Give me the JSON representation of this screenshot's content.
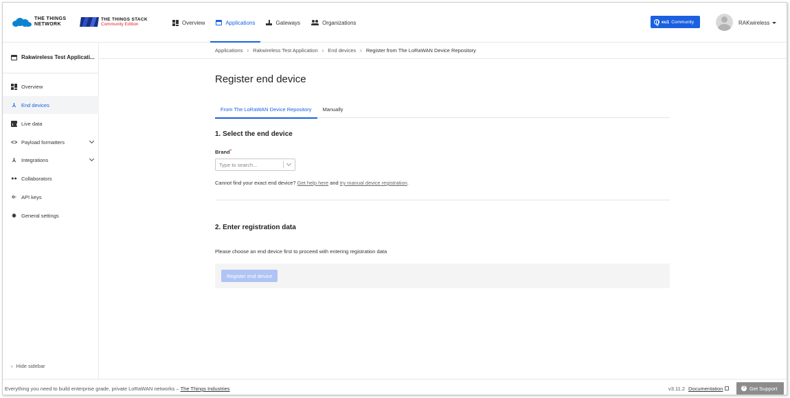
{
  "header": {
    "logo_ttn_line1": "THE THINGS",
    "logo_ttn_line2": "NETWORK",
    "logo_tts_line1": "THE THINGS STACK",
    "logo_tts_line2": "Community Edition",
    "nav": [
      {
        "label": "Overview",
        "icon": "grid-icon"
      },
      {
        "label": "Applications",
        "icon": "application-icon",
        "active": true
      },
      {
        "label": "Gateways",
        "icon": "gateway-icon"
      },
      {
        "label": "Organizations",
        "icon": "organizations-icon"
      }
    ],
    "cluster_region": "eu1",
    "cluster_label": "Community",
    "username": "RAKwireless"
  },
  "sidebar": {
    "app_title": "Rakwireless Test Applicati...",
    "items": [
      {
        "label": "Overview",
        "icon": "dashboard-icon"
      },
      {
        "label": "End devices",
        "icon": "device-hub-icon",
        "active": true
      },
      {
        "label": "Live data",
        "icon": "live-data-icon"
      },
      {
        "label": "Payload formatters",
        "icon": "code-icon",
        "expandable": true
      },
      {
        "label": "Integrations",
        "icon": "integrations-icon",
        "expandable": true
      },
      {
        "label": "Collaborators",
        "icon": "people-icon"
      },
      {
        "label": "API keys",
        "icon": "key-icon"
      },
      {
        "label": "General settings",
        "icon": "gear-icon"
      }
    ],
    "hide_label": "Hide sidebar"
  },
  "breadcrumb": [
    "Applications",
    "Rakwireless Test Application",
    "End devices",
    "Register from The LoRaWAN Device Repository"
  ],
  "main": {
    "title": "Register end device",
    "tabs": [
      {
        "label": "From The LoRaWAN Device Repository",
        "active": true
      },
      {
        "label": "Manually"
      }
    ],
    "section1_title": "1. Select the end device",
    "brand_label": "Brand",
    "brand_required": "*",
    "brand_placeholder": "Type to search...",
    "brand_value": "",
    "help_prefix": "Cannot find your exact end device?",
    "help_link1": "Get help here",
    "help_and": "and",
    "help_link2": "try manual device registration",
    "help_suffix": ".",
    "section2_title": "2. Enter registration data",
    "section2_info": "Please choose an end device first to proceed with entering registration data",
    "submit_label": "Register end device"
  },
  "footer": {
    "tagline": "Everything you need to build enterprise grade, private LoRaWAN networks –",
    "company_link": "The Things Industries",
    "version": "v3.11.2",
    "documentation": "Documentation",
    "support": "Get Support"
  },
  "colors": {
    "accent": "#1a60e0",
    "disabled_button": "#aec4f4",
    "required": "#e0242c",
    "support_button": "#8c8c8c"
  }
}
